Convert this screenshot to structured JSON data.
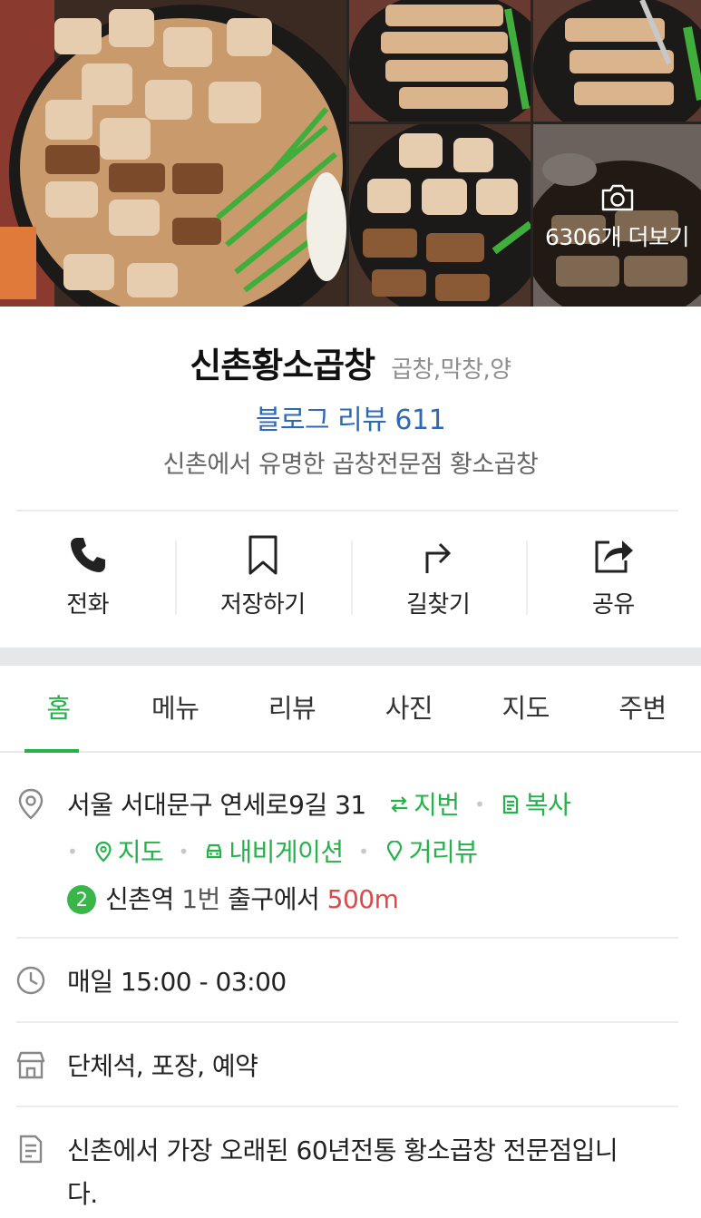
{
  "photos": {
    "more_label": "6306개 더보기",
    "icons": {
      "more": "camera-icon"
    }
  },
  "place": {
    "name": "신촌황소곱창",
    "category": "곱창,막창,양",
    "blog_review": "블로그 리뷰 611",
    "description": "신촌에서 유명한 곱창전문점 황소곱창"
  },
  "actions": [
    {
      "label": "전화",
      "icon": "phone-icon"
    },
    {
      "label": "저장하기",
      "icon": "bookmark-icon"
    },
    {
      "label": "길찾기",
      "icon": "directions-icon"
    },
    {
      "label": "공유",
      "icon": "share-icon"
    }
  ],
  "tabs": [
    {
      "label": "홈",
      "active": true
    },
    {
      "label": "메뉴"
    },
    {
      "label": "리뷰"
    },
    {
      "label": "사진"
    },
    {
      "label": "지도"
    },
    {
      "label": "주변"
    }
  ],
  "address": {
    "text": "서울 서대문구 연세로9길 31",
    "jibun": "지번",
    "copy": "복사",
    "map": "지도",
    "navigation": "내비게이션",
    "streetview": "거리뷰"
  },
  "subway": {
    "line": "2",
    "station": "신촌역",
    "exit": "1번",
    "exit_suffix": "출구에서",
    "distance": "500m"
  },
  "hours": "매일 15:00 - 03:00",
  "facilities": "단체석, 포장, 예약",
  "intro": {
    "line1": "신촌에서 가장 오래된 60년전통 황소곱창 전문점입니",
    "line2": "다."
  },
  "colors": {
    "accent_green": "#25b24a",
    "link_blue": "#2e68b8",
    "distance_red": "#e24848",
    "subway_line2": "#39b54a"
  }
}
